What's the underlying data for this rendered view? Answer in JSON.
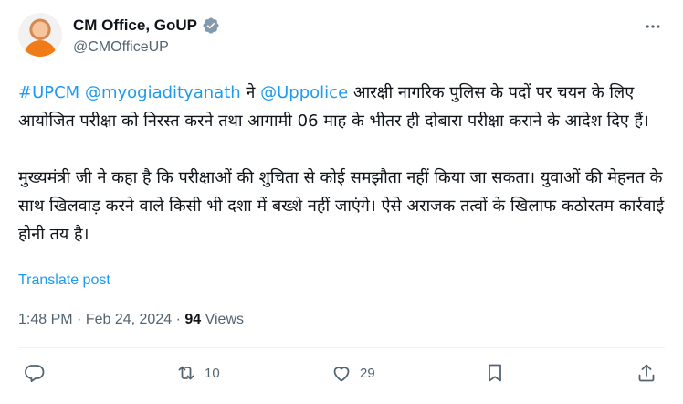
{
  "author": {
    "display_name": "CM Office, GoUP",
    "handle": "@CMOfficeUP",
    "avatar_icon": "avatar-photo",
    "verified_icon": "verified-badge-icon"
  },
  "more_icon": "more-options-icon",
  "tweet": {
    "p1": {
      "hashtag": "#UPCM",
      "mention1": "@myogiadityanath",
      "t1": " ने ",
      "mention2": "@Uppolice",
      "t2": " आरक्षी नागरिक पुलिस के पदों पर चयन के लिए आयोजित परीक्षा को निरस्त करने तथा आगामी 06 माह के भीतर ही दोबारा परीक्षा कराने के आदेश दिए हैं।"
    },
    "p2": "मुख्यमंत्री जी ने कहा है कि परीक्षाओं की शुचिता से कोई समझौता नहीं किया जा सकता। युवाओं की मेहनत के साथ खिलवाड़ करने वाले किसी भी दशा में बख्शे नहीं जाएंगे। ऐसे अराजक तत्वों के खिलाफ कठोरतम कार्रवाई होनी तय है।"
  },
  "translate_label": "Translate post",
  "meta": {
    "time": "1:48 PM",
    "separator": "·",
    "date": "Feb 24, 2024",
    "views_count": "94",
    "views_label": "Views"
  },
  "actions": {
    "reply": {
      "icon": "reply-icon",
      "count": ""
    },
    "repost": {
      "icon": "repost-icon",
      "count": "10"
    },
    "like": {
      "icon": "like-icon",
      "count": "29"
    },
    "bookmark": {
      "icon": "bookmark-icon",
      "count": ""
    },
    "share": {
      "icon": "share-icon",
      "count": ""
    }
  },
  "colors": {
    "link": "#1d9bf0",
    "text": "#0f1419",
    "secondary": "#536471",
    "verified": "#829aab"
  }
}
